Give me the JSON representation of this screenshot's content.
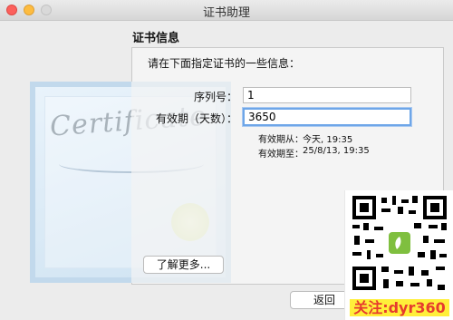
{
  "window": {
    "title": "证书助理"
  },
  "section_title": "证书信息",
  "prompt": "请在下面指定证书的一些信息：",
  "form": {
    "serial_label": "序列号：",
    "serial_value": "1",
    "validity_label": "有效期（天数）：",
    "validity_value": "3650"
  },
  "validity": {
    "from_label": "有效期从：",
    "from_value": "今天, 19:35",
    "to_label": "有效期至：",
    "to_value": "25/8/13, 19:35"
  },
  "certificate_art_text": "Certificate",
  "buttons": {
    "learn_more": "了解更多...",
    "back": "返回"
  },
  "watermark": {
    "text": "关注:dyr360",
    "text_color": "#e63b2e",
    "highlight_color": "#ffef3a"
  }
}
